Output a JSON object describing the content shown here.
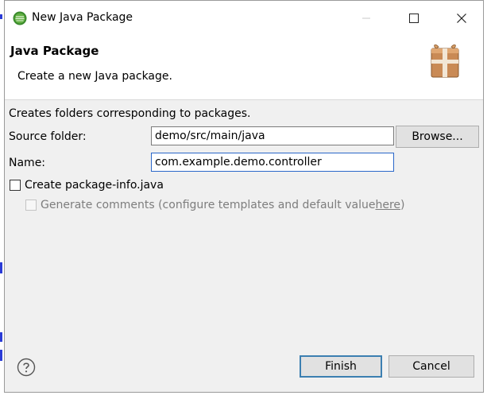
{
  "window": {
    "title": "New Java Package",
    "controls": {
      "minimize": "—",
      "maximize": "☐",
      "close": "✕"
    }
  },
  "header": {
    "title": "Java Package",
    "description": "Create a new Java package."
  },
  "form": {
    "info": "Creates folders corresponding to packages.",
    "source_folder": {
      "label": "Source folder:",
      "value": "demo/src/main/java",
      "browse_label": "Browse..."
    },
    "name": {
      "label": "Name:",
      "value": "com.example.demo.controller"
    },
    "create_package_info": {
      "label": "Create package-info.java",
      "checked": false
    },
    "generate_comments": {
      "label_before": "Generate comments (configure templates and default value ",
      "link": "here",
      "label_after": ")",
      "checked": false,
      "enabled": false
    }
  },
  "footer": {
    "help_icon": "question-circle-icon",
    "finish_label": "Finish",
    "cancel_label": "Cancel"
  },
  "icons": {
    "app": "eclipse-icon",
    "banner": "package-icon"
  },
  "colors": {
    "dialog_bg": "#f0f0f0",
    "header_bg": "#ffffff",
    "focus_border": "#2a67c9",
    "default_button_border": "#3c7fb1"
  }
}
